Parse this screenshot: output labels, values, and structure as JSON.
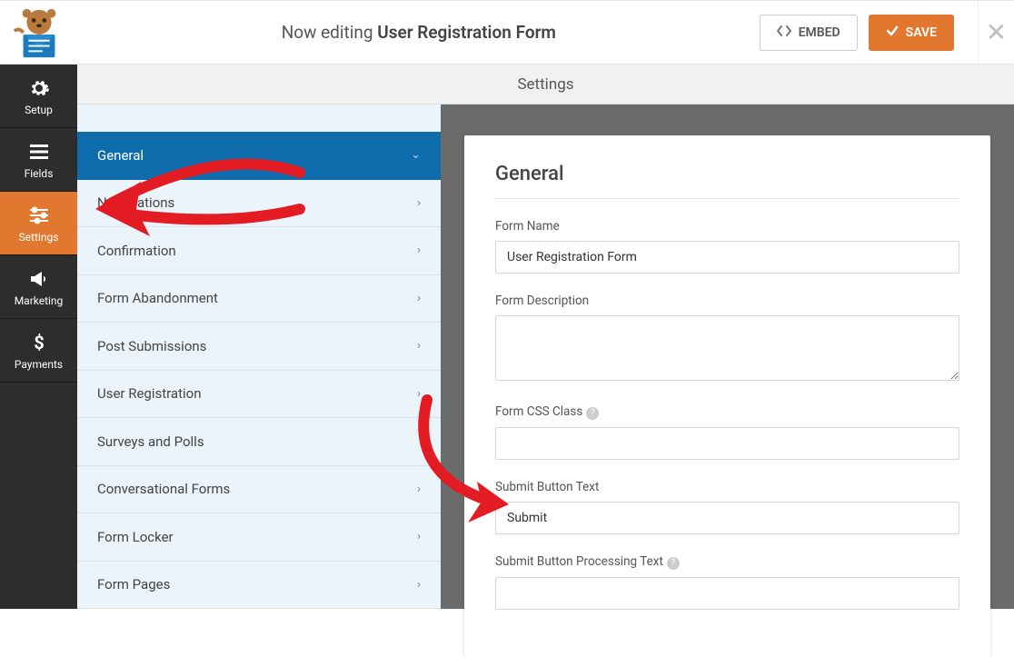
{
  "header": {
    "prefix": "Now editing ",
    "title": "User Registration Form",
    "embed": "EMBED",
    "save": "SAVE"
  },
  "nav": [
    {
      "label": "Setup",
      "icon": "gear"
    },
    {
      "label": "Fields",
      "icon": "list"
    },
    {
      "label": "Settings",
      "icon": "sliders",
      "active": true
    },
    {
      "label": "Marketing",
      "icon": "bullhorn"
    },
    {
      "label": "Payments",
      "icon": "dollar"
    }
  ],
  "page_title": "Settings",
  "side_items": [
    {
      "label": "General",
      "active": true,
      "chev": "down"
    },
    {
      "label": "Notifications",
      "chev": "right"
    },
    {
      "label": "Confirmation",
      "chev": "right"
    },
    {
      "label": "Form Abandonment",
      "chev": "right"
    },
    {
      "label": "Post Submissions",
      "chev": "right"
    },
    {
      "label": "User Registration",
      "chev": "right"
    },
    {
      "label": "Surveys and Polls"
    },
    {
      "label": "Conversational Forms",
      "chev": "right"
    },
    {
      "label": "Form Locker",
      "chev": "right"
    },
    {
      "label": "Form Pages",
      "chev": "right"
    }
  ],
  "panel": {
    "heading": "General",
    "form_name_label": "Form Name",
    "form_name_value": "User Registration Form",
    "form_desc_label": "Form Description",
    "form_desc_value": "",
    "css_label": "Form CSS Class",
    "css_value": "",
    "submit_text_label": "Submit Button Text",
    "submit_text_value": "Submit",
    "submit_proc_label": "Submit Button Processing Text",
    "submit_proc_value": ""
  }
}
